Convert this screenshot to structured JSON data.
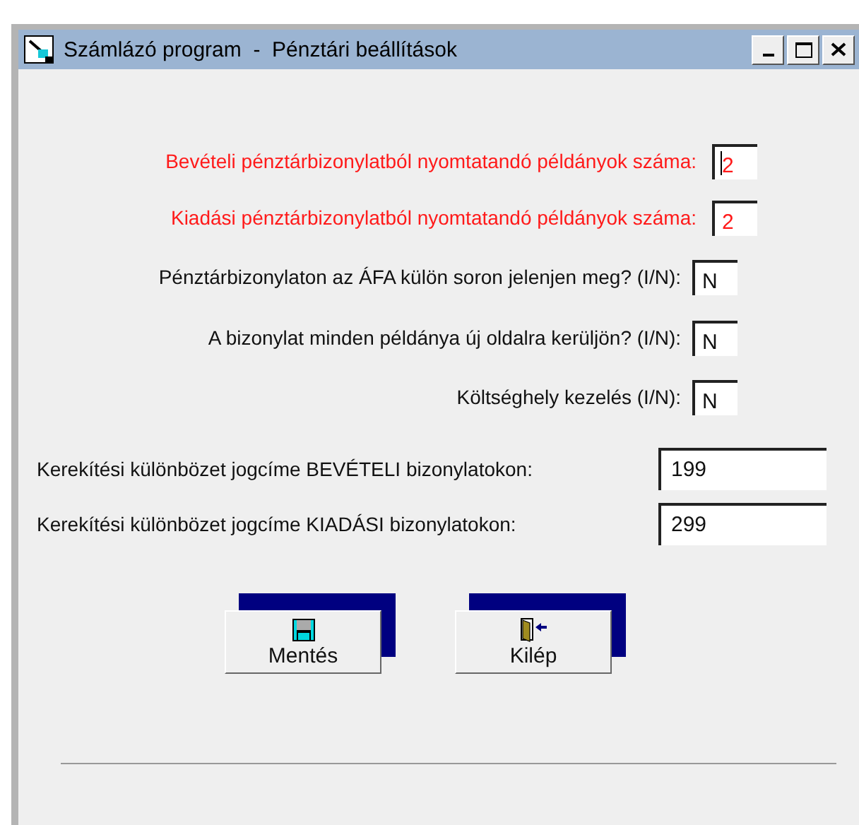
{
  "window": {
    "title": "Számlázó program  -  Pénztári beállítások"
  },
  "settings": [
    {
      "label": "Bevételi pénztárbizonylatból nyomtatandó példányok száma:",
      "value": "2",
      "emphasized": true,
      "focused": true
    },
    {
      "label": "Kiadási pénztárbizonylatból nyomtatandó példányok száma:",
      "value": "2",
      "emphasized": true,
      "focused": false
    },
    {
      "label": "Pénztárbizonylaton az ÁFA külön soron jelenjen meg? (I/N):",
      "value": "N",
      "emphasized": false,
      "focused": false
    },
    {
      "label": "A bizonylat minden példánya új oldalra kerüljön? (I/N):",
      "value": "N",
      "emphasized": false,
      "focused": false
    },
    {
      "label": "Költséghely kezelés (I/N):",
      "value": "N",
      "emphasized": false,
      "focused": false
    }
  ],
  "rounding": [
    {
      "label": "Kerekítési különbözet jogcíme BEVÉTELI bizonylatokon:",
      "value": "199"
    },
    {
      "label": "Kerekítési különbözet jogcíme KIADÁSI bizonylatokon:",
      "value": "299"
    }
  ],
  "buttons": [
    {
      "label": "Mentés",
      "kind": "save"
    },
    {
      "label": "Kilép",
      "kind": "exit"
    }
  ]
}
